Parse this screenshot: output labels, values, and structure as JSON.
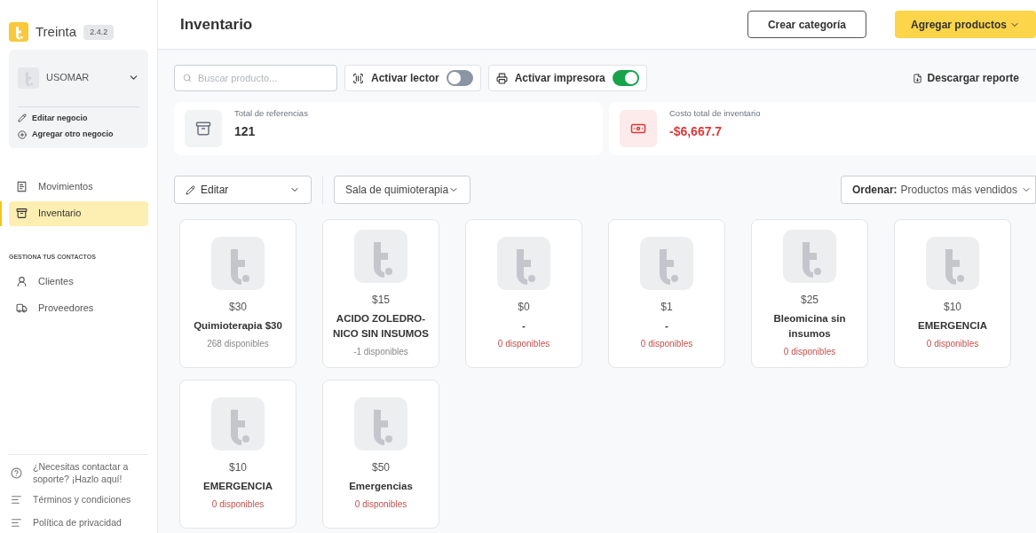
{
  "brand": {
    "name": "Treinta",
    "version": "2.4.2"
  },
  "account": {
    "name": "USOMAR",
    "actions": [
      {
        "kind": "edit",
        "label": "Editar negocio"
      },
      {
        "kind": "add",
        "label": "Agregar otro negocio"
      }
    ]
  },
  "nav": [
    {
      "kind": "movements",
      "label": "Movimientos",
      "selected": false
    },
    {
      "kind": "inventory",
      "label": "Inventario",
      "selected": true
    }
  ],
  "contacts": {
    "heading": "GESTIONA TUS CONTACTOS",
    "items": [
      {
        "kind": "clients",
        "label": "Clientes",
        "selected": false
      },
      {
        "kind": "suppliers",
        "label": "Proveedores",
        "selected": false
      }
    ]
  },
  "footer_links": [
    {
      "kind": "help",
      "label": "¿Necesitas contactar a soporte? ¡Hazlo aquí!"
    },
    {
      "kind": "terms",
      "label": "Términos y condiciones"
    },
    {
      "kind": "privacy",
      "label": "Política de privacidad"
    }
  ],
  "header": {
    "title": "Inventario",
    "buttons": [
      {
        "kind": "outline",
        "label": "Crear categoría"
      },
      {
        "kind": "primary",
        "label": "Agregar productos"
      }
    ]
  },
  "toolbar": {
    "search": {
      "placeholder": "Buscar producto..."
    },
    "toggles": [
      {
        "kind": "scanner",
        "label": "Activar lector",
        "on": false
      },
      {
        "kind": "printer",
        "label": "Activar impresora",
        "on": true
      }
    ],
    "report": "Descargar reporte"
  },
  "stats": [
    {
      "kind": "references",
      "label": "Total de referencias",
      "value": "121",
      "negative": false
    },
    {
      "kind": "cost",
      "label": "Costo total de inventario",
      "value": "-$6,667.7",
      "negative": true
    }
  ],
  "filters": {
    "edit": "Editar",
    "category": "Sala de quimioterapia",
    "sort_label": "Ordenar:",
    "sort_value": "Productos más vendidos"
  },
  "products": [
    {
      "price": "$30",
      "name": "Quimioterapia $30",
      "stock": "268 disponibles",
      "out_of_stock": false
    },
    {
      "price": "$15",
      "name": "ACIDO ZOLEDRO-NICO SIN INSUMOS",
      "stock": "-1 disponibles",
      "out_of_stock": false
    },
    {
      "price": "$0",
      "name": "-",
      "stock": "0 disponibles",
      "out_of_stock": true
    },
    {
      "price": "$1",
      "name": "-",
      "stock": "0 disponibles",
      "out_of_stock": true
    },
    {
      "price": "$25",
      "name": "Bleomicina sin insumos",
      "stock": "0 disponibles",
      "out_of_stock": true
    },
    {
      "price": "$10",
      "name": "EMERGENCIA",
      "stock": "0 disponibles",
      "out_of_stock": true
    },
    {
      "price": "$10",
      "name": "EMERGENCIA",
      "stock": "0 disponibles",
      "out_of_stock": true
    },
    {
      "price": "$50",
      "name": "Emergencias",
      "stock": "0 disponibles",
      "out_of_stock": true
    }
  ]
}
